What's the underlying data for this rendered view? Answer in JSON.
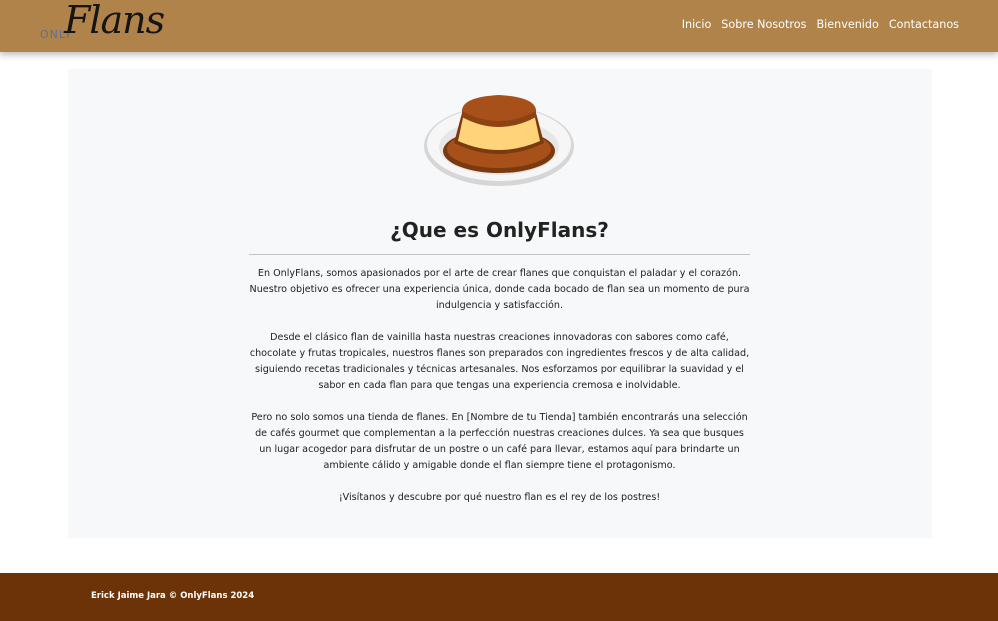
{
  "brand": {
    "only": "ONLY",
    "flans": "Flans"
  },
  "nav": {
    "items": [
      "Inicio",
      "Sobre Nosotros",
      "Bienvenido",
      "Contactanos"
    ]
  },
  "main": {
    "image": "flan-on-plate",
    "title": "¿Que es OnlyFlans?",
    "paragraphs": [
      "En OnlyFlans, somos apasionados por el arte de crear flanes que conquistan el paladar y el corazón. Nuestro objetivo es ofrecer una experiencia única, donde cada bocado de flan sea un momento de pura indulgencia y satisfacción.",
      "Desde el clásico flan de vainilla hasta nuestras creaciones innovadoras con sabores como café, chocolate y frutas tropicales, nuestros flanes son preparados con ingredientes frescos y de alta calidad, siguiendo recetas tradicionales y técnicas artesanales. Nos esforzamos por equilibrar la suavidad y el sabor en cada flan para que tengas una experiencia cremosa e inolvidable.",
      "Pero no solo somos una tienda de flanes. En [Nombre de tu Tienda] también encontrarás una selección de cafés gourmet que complementan a la perfección nuestras creaciones dulces. Ya sea que busques un lugar acogedor para disfrutar de un postre o un café para llevar, estamos aquí para brindarte un ambiente cálido y amigable donde el flan siempre tiene el protagonismo.",
      "¡Visítanos y descubre por qué nuestro flan es el rey de los postres!"
    ]
  },
  "footer": {
    "text": "Erick Jaime Jara © OnlyFlans 2024"
  },
  "colors": {
    "navbar": "#b0834a",
    "card": "#f7f8f9",
    "footer": "#6b3307",
    "caramel": "#a8501a",
    "custard": "#ffd37a"
  }
}
